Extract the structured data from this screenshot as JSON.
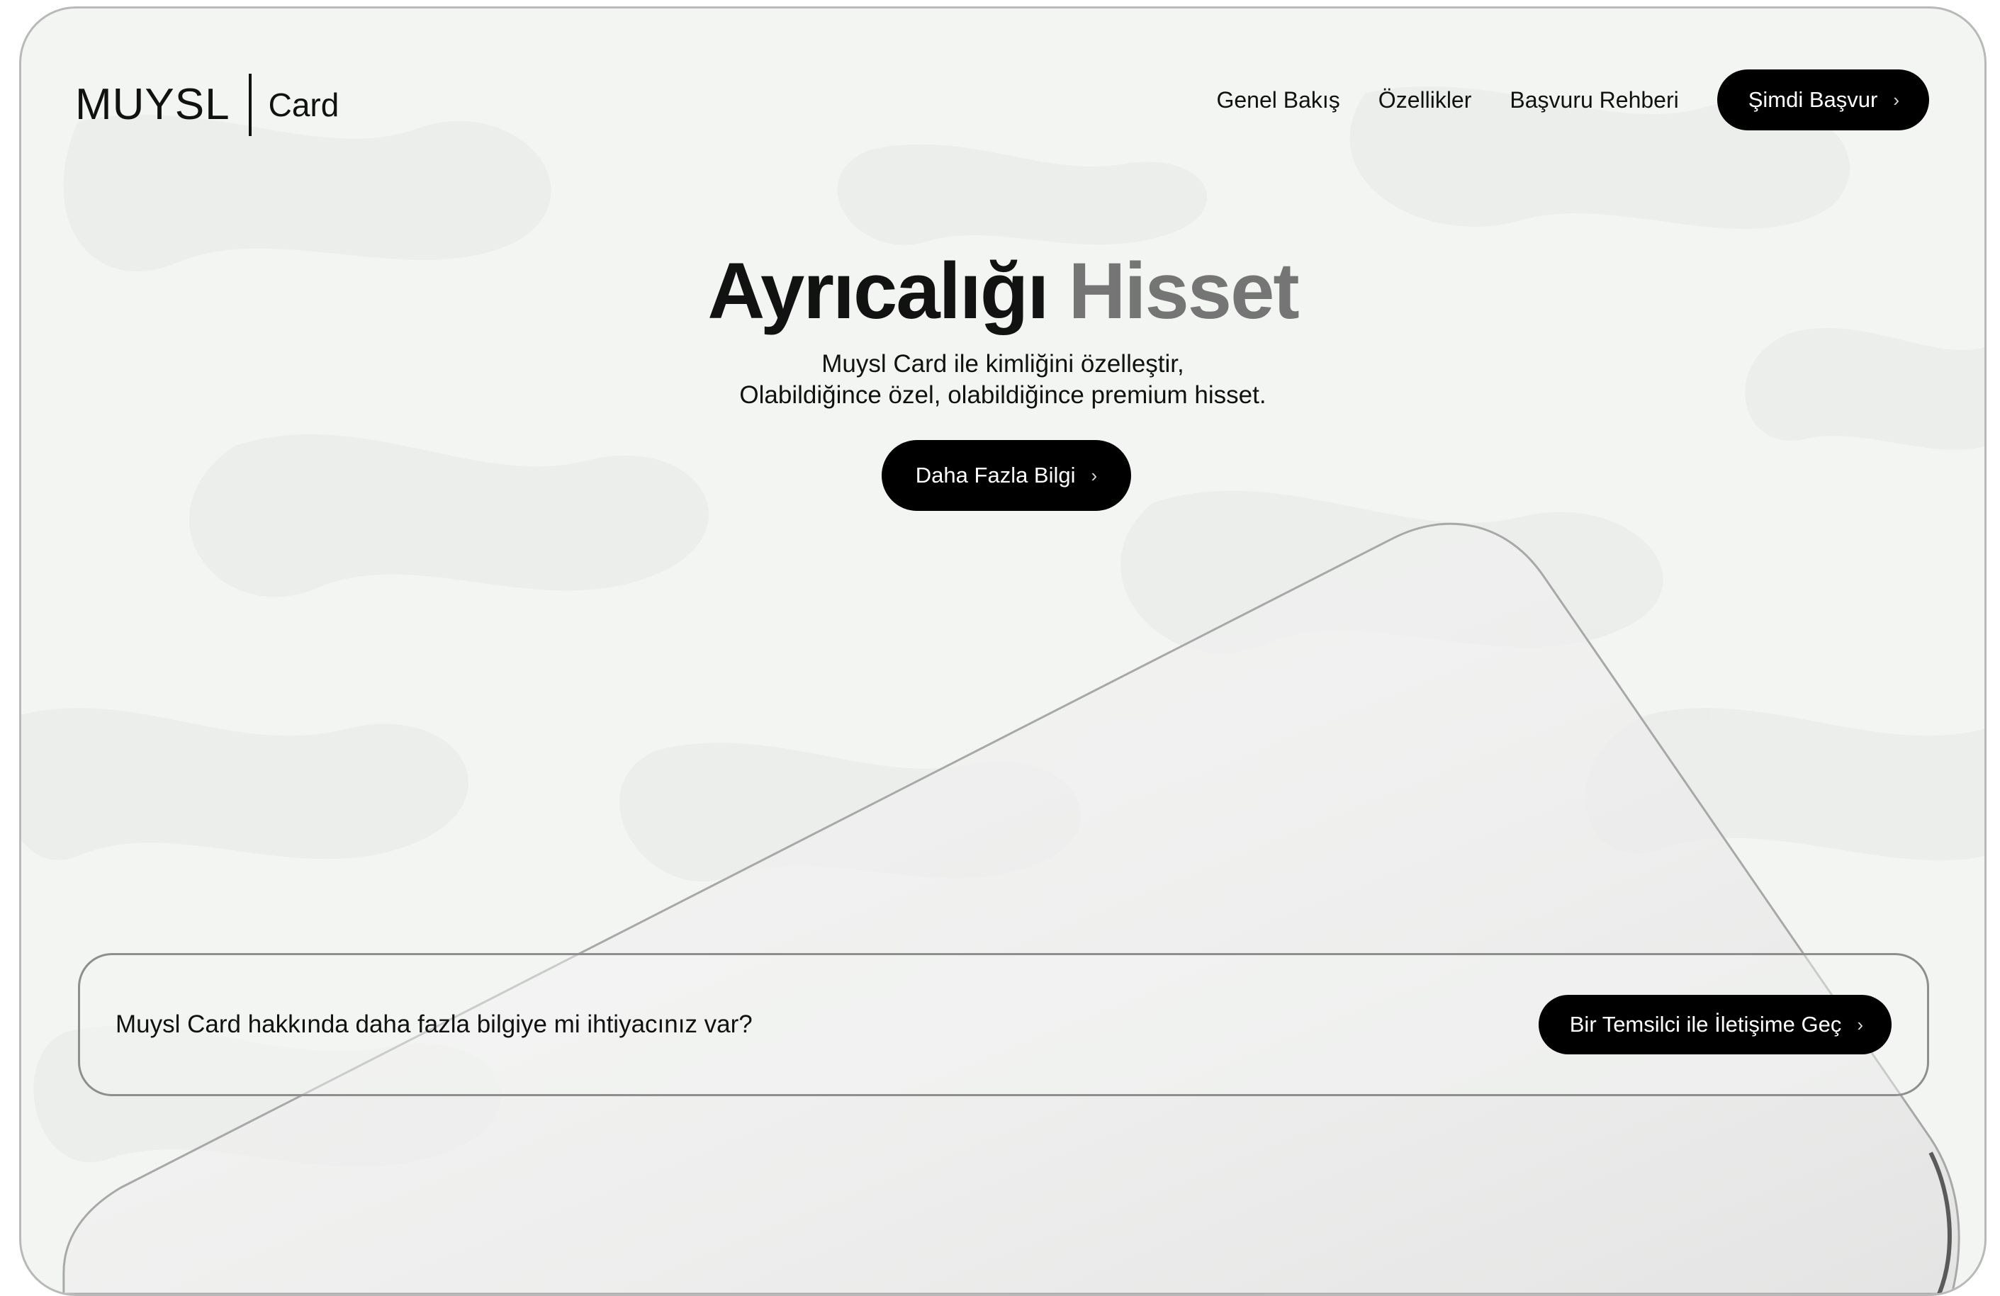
{
  "header": {
    "brand_logo": "MUYSL",
    "brand_sub": "Card",
    "nav": [
      {
        "label": "Genel Bakış"
      },
      {
        "label": "Özellikler"
      },
      {
        "label": "Başvuru Rehberi"
      }
    ],
    "apply_label": "Şimdi Başvur"
  },
  "hero": {
    "title_part1": "Ayrıcalığı",
    "title_part2": "Hisset",
    "subtitle_line1": "Muysl Card ile kimliğini özelleştir,",
    "subtitle_line2": "Olabildiğince özel, olabildiğince premium hisset.",
    "more_label": "Daha Fazla Bilgi"
  },
  "info_bar": {
    "question": "Muysl Card hakkında daha fazla bilgiye mi ihtiyacınız var?",
    "contact_label": "Bir Temsilci ile İletişime Geç"
  },
  "icons": {
    "chevron": "chevron-right-icon"
  },
  "colors": {
    "background": "#f3f5f2",
    "primary_button": "#000000",
    "button_text": "#ffffff",
    "title_dark": "#121212",
    "title_muted": "#757575"
  }
}
